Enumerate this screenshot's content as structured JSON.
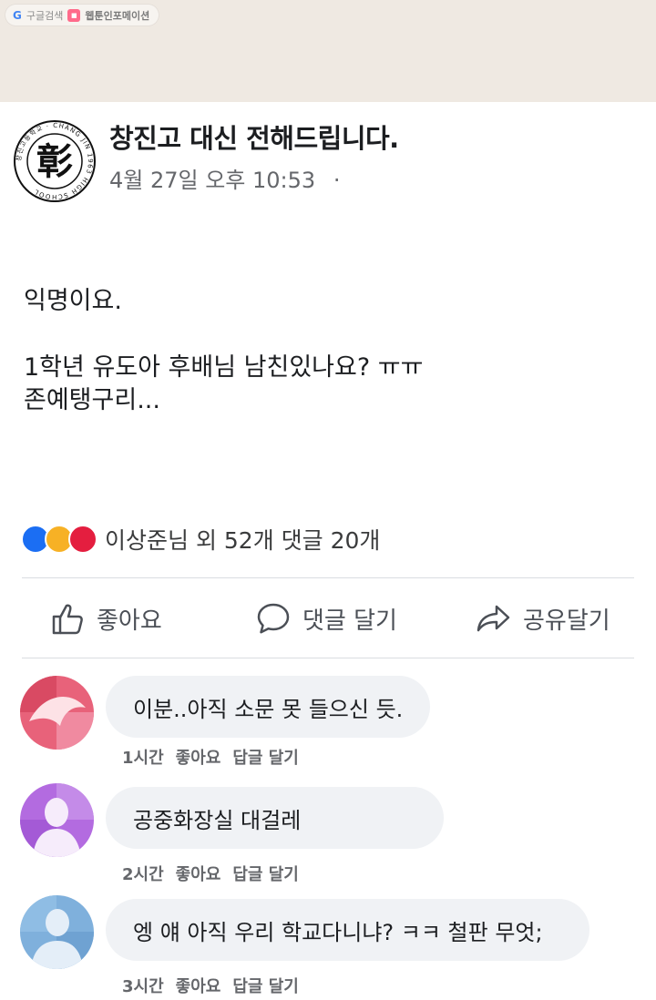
{
  "top_bar": {
    "google_letter": "G",
    "google_label": "구글검색",
    "webtoon_label": "웹툰인포메이션"
  },
  "post": {
    "page_name": "창진고 대신 전해드립니다.",
    "timestamp": "4월 27일 오후 10:53",
    "separator": "·",
    "body_line1": "익명이요.",
    "body_line2": "1학년 유도아 후배님 남친있나요? ㅠㅠ",
    "body_line3": "존예탱구리..."
  },
  "logo": {
    "center_char": "彰",
    "ring_text": "창진고등학교 · CHANG JIN 1963 HIGH SCHOOL"
  },
  "reactions": {
    "summary": "이상준님 외 52개  댓글 20개",
    "colors": [
      "#1b6ef3",
      "#f7b125",
      "#e41e3f"
    ]
  },
  "actions": {
    "like": "좋아요",
    "comment": "댓글 달기",
    "share": "공유달기"
  },
  "comments": [
    {
      "text": "이분..아직 소문 못 들으신 듯.",
      "time": "1시간",
      "like": "좋아요",
      "reply": "답글 달기"
    },
    {
      "text": "공중화장실 대걸레",
      "time": "2시간",
      "like": "좋아요",
      "reply": "답글 달기"
    },
    {
      "text": "엥 얘 아직 우리 학교다니냐? ㅋㅋ 철판 무엇;",
      "time": "3시간",
      "like": "좋아요",
      "reply": "답글 달기"
    }
  ]
}
